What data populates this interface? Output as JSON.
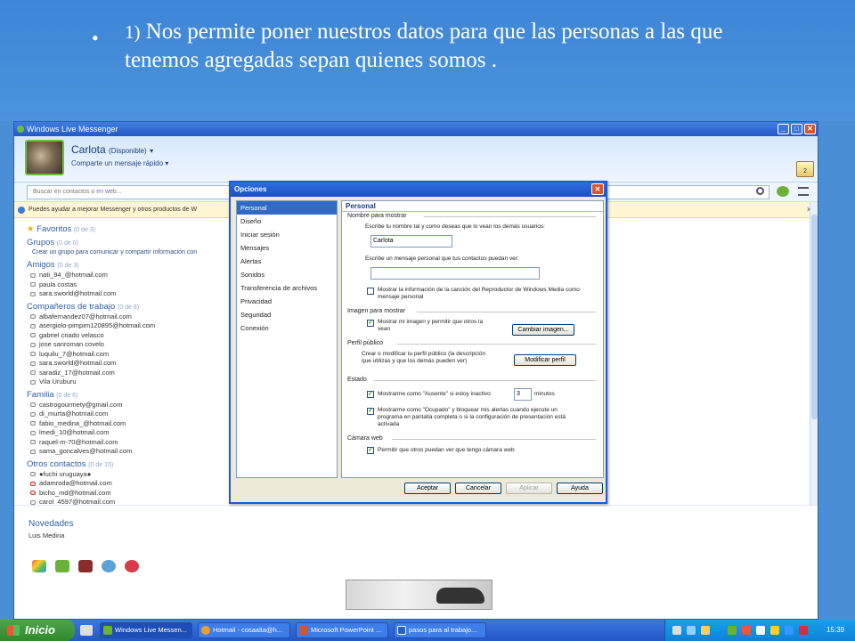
{
  "slide": {
    "bullet": "•",
    "number": "1)",
    "text": " Nos permite poner nuestros datos para que las personas a las que tenemos agregadas sepan quienes somos ."
  },
  "messenger": {
    "window_title": "Windows Live Messenger",
    "user_name": "Carlota",
    "user_status": "(Disponible)",
    "personal_message": "Comparte un mensaje rápido",
    "inbox_count": "2",
    "search_placeholder": "Buscar en contactos o en web...",
    "info_bar": "Puedes ayudar a mejorar Messenger y otros productos de W",
    "groups": {
      "favoritos": {
        "title": "Favoritos",
        "count": "(0 de 3)"
      },
      "grupos": {
        "title": "Grupos",
        "count": "(0 de 0)",
        "sub": "Crear un grupo para comunicar y compartir información con"
      },
      "amigos": {
        "title": "Amigos",
        "count": "(0 de 3)",
        "contacts": [
          "nati_94_@hotmail.com",
          "paula costas",
          "sara.sworld@hotmail.com"
        ]
      },
      "trabajo": {
        "title": "Compañeros de trabajo",
        "count": "(0 de 8)",
        "contacts": [
          "albafernandez07@hotmail.com",
          "asergiolo-pimpim120895@hotmail.com",
          "gabriel criado velasco",
          "jose sanroman covelo",
          "luquilu_7@hotmail.com",
          "sara.sworld@hotmail.com",
          "saradiz_17@hotmail.com",
          "Vila Uruburu"
        ]
      },
      "familia": {
        "title": "Familia",
        "count": "(0 de 6)",
        "contacts": [
          "castrogourmety@gmail.com",
          "di_murta@hotmail.com",
          "fabio_medina_@hotmail.com",
          "lmedi_10@hotmail.com",
          "raquel-m-70@hotmail.com",
          "sama_goncalves@hotmail.com"
        ]
      },
      "otros": {
        "title": "Otros contactos",
        "count": "(0 de 15)",
        "contacts": [
          "●fuchi uruguaya●",
          "adamroda@hotmail.com",
          "bicho_md@hotmail.com",
          "carol_4597@hotmail.com"
        ]
      }
    },
    "news_title": "Novedades",
    "news_item": "Luis Medina"
  },
  "dialog": {
    "title": "Opciones",
    "nav": [
      "Personal",
      "Diseño",
      "Iniciar sesión",
      "Mensajes",
      "Alertas",
      "Sonidos",
      "Transferencia de archivos",
      "Privacidad",
      "Seguridad",
      "Conexión"
    ],
    "panel_title": "Personal",
    "sec_nombre": "Nombre para mostrar",
    "lbl_nombre": "Escribe tu nombre tal y como deseas que lo vean los demás usuarios:",
    "nombre_value": "Carlota",
    "lbl_mensaje": "Escribe un mensaje personal que tus contactos puedan ver:",
    "mensaje_value": "",
    "chk_cancion": "Mostrar la información de la canción del Reproductor de Windows Media como mensaje personal",
    "sec_imagen": "Imagen para mostrar",
    "chk_imagen": "Mostrar mi imagen y permitir que otros la vean",
    "btn_cambiar": "Cambiar imagen...",
    "sec_perfil": "Perfil público",
    "lbl_perfil": "Crear o modificar tu perfil público (la descripción que utilizas y que los demás pueden ver)",
    "btn_perfil": "Modificar perfil",
    "sec_estado": "Estado",
    "chk_ausente": "Mostrarme como \"Ausente\" si estoy inactivo",
    "minutes_value": "3",
    "lbl_minutos": "minutos",
    "chk_ocupado": "Mostrarme como \"Ocupado\" y bloquear mis alertas cuando ejecute un programa en pantalla completa o si la configuración de presentación está activada",
    "sec_camara": "Cámara web",
    "chk_camara": "Permitir que otros puedan ver que tengo cámara web",
    "btn_aceptar": "Aceptar",
    "btn_cancelar": "Cancelar",
    "btn_aplicar": "Aplicar",
    "btn_ayuda": "Ayuda"
  },
  "taskbar": {
    "start": "Inicio",
    "tasks": [
      "Windows Live Messen...",
      "Hotmail - cosaalta@h...",
      "Microsoft PowerPoint ...",
      "pasos para al trabajo..."
    ],
    "clock": "15:39"
  }
}
